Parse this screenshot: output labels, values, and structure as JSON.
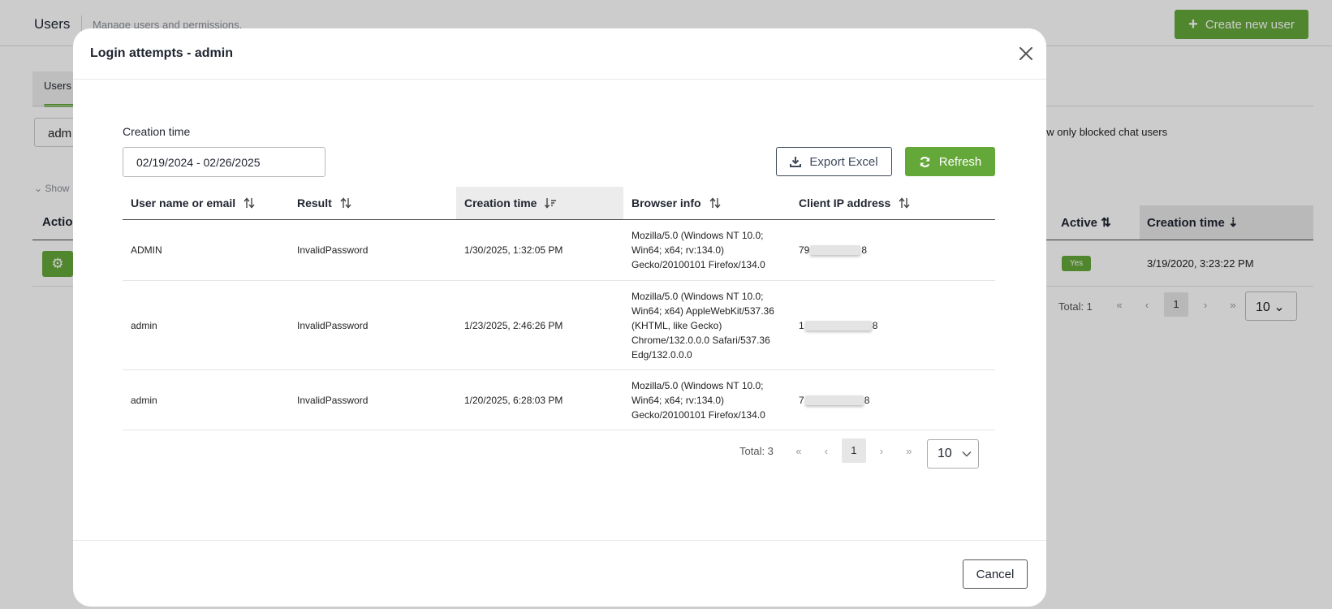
{
  "background": {
    "title": "Users",
    "subtitle": "Manage users and permissions.",
    "create_button": "Create new user",
    "tab_users": "Users",
    "search_value": "adm",
    "blocked_label": "ow only blocked chat users",
    "show_link": "Show",
    "actions_header": "Action",
    "active_header": "Active",
    "creation_time_header": "Creation time",
    "active_badge": "Yes",
    "creation_time_value": "3/19/2020, 3:23:22 PM",
    "total": "Total: 1",
    "current_page": "1",
    "page_size": "10"
  },
  "modal": {
    "title": "Login attempts - admin",
    "filter_label": "Creation time",
    "date_range": "02/19/2024 - 02/26/2025",
    "export_button": "Export Excel",
    "refresh_button": "Refresh",
    "cancel_button": "Cancel",
    "columns": [
      "User name or email",
      "Result",
      "Creation time",
      "Browser info",
      "Client IP address"
    ],
    "rows": [
      {
        "user": "ADMIN",
        "result": "InvalidPassword",
        "time": "1/30/2025, 1:32:05 PM",
        "browser": "Mozilla/5.0 (Windows NT 10.0; Win64; x64; rv:134.0) Gecko/20100101 Firefox/134.0",
        "ip_start": "79",
        "ip_end": "8"
      },
      {
        "user": "admin",
        "result": "InvalidPassword",
        "time": "1/23/2025, 2:46:26 PM",
        "browser": "Mozilla/5.0 (Windows NT 10.0; Win64; x64) AppleWebKit/537.36 (KHTML, like Gecko) Chrome/132.0.0.0 Safari/537.36 Edg/132.0.0.0",
        "ip_start": "1",
        "ip_end": "8"
      },
      {
        "user": "admin",
        "result": "InvalidPassword",
        "time": "1/20/2025, 6:28:03 PM",
        "browser": "Mozilla/5.0 (Windows NT 10.0; Win64; x64; rv:134.0) Gecko/20100101 Firefox/134.0",
        "ip_start": "7",
        "ip_end": "8"
      }
    ],
    "pagination": {
      "total": "Total: 3",
      "current_page": "1",
      "page_size": "10"
    }
  },
  "colors": {
    "accent": "#65a83a",
    "overlay": "#333333"
  }
}
